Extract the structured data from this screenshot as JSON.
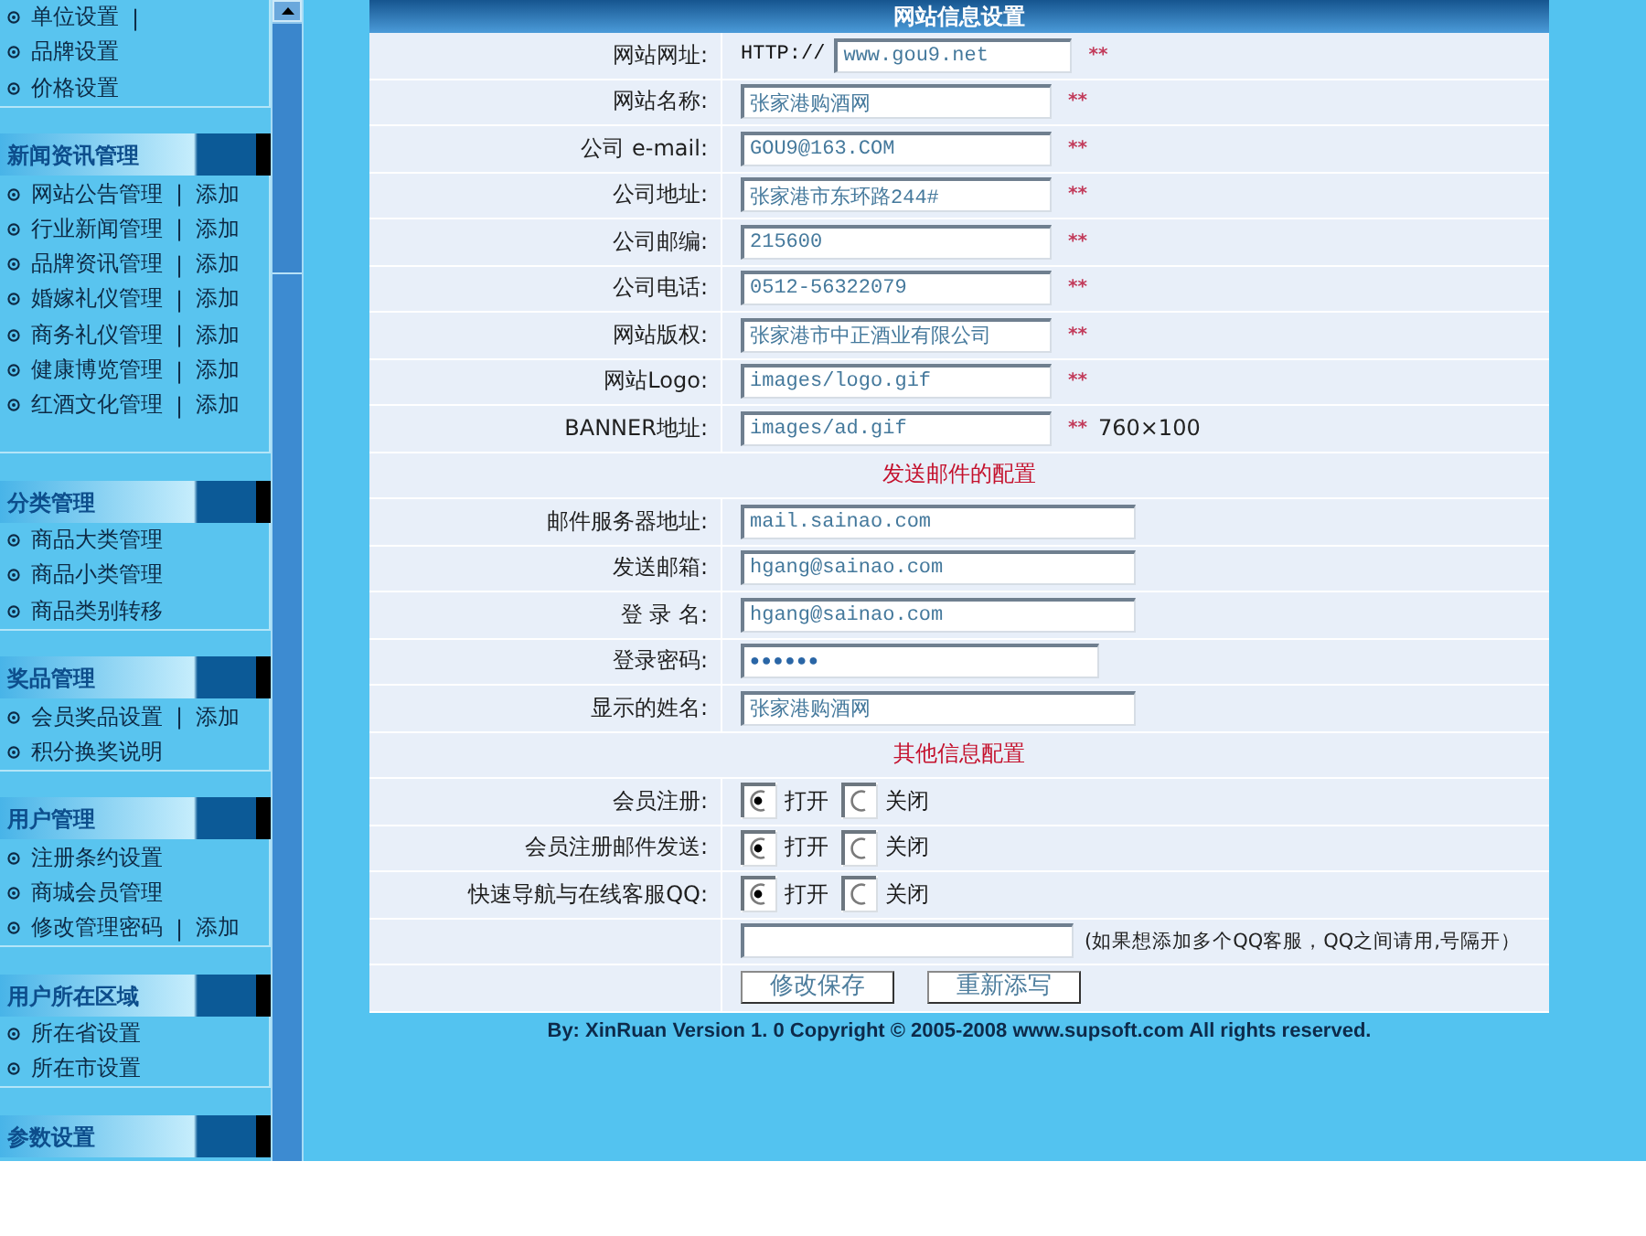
{
  "sidebar": {
    "sections": [
      {
        "items": [
          {
            "label": "单位设置",
            "separator": "|"
          },
          {
            "label": "品牌设置"
          },
          {
            "label": "价格设置"
          }
        ]
      },
      {
        "title": "新闻资讯管理",
        "items": [
          {
            "label": "网站公告管理",
            "separator": "|",
            "action": "添加"
          },
          {
            "label": "行业新闻管理",
            "separator": "|",
            "action": "添加"
          },
          {
            "label": "品牌资讯管理",
            "separator": "|",
            "action": "添加"
          },
          {
            "label": "婚嫁礼仪管理",
            "separator": "|",
            "action": "添加"
          },
          {
            "label": "商务礼仪管理",
            "separator": "|",
            "action": "添加"
          },
          {
            "label": "健康博览管理",
            "separator": "|",
            "action": "添加"
          },
          {
            "label": "红酒文化管理",
            "separator": "|",
            "action": "添加"
          }
        ]
      },
      {
        "title": "分类管理",
        "items": [
          {
            "label": "商品大类管理"
          },
          {
            "label": "商品小类管理"
          },
          {
            "label": "商品类别转移"
          }
        ]
      },
      {
        "title": "奖品管理",
        "items": [
          {
            "label": "会员奖品设置",
            "separator": "|",
            "action": "添加"
          },
          {
            "label": "积分换奖说明"
          }
        ]
      },
      {
        "title": "用户管理",
        "items": [
          {
            "label": "注册条约设置"
          },
          {
            "label": "商城会员管理"
          },
          {
            "label": "修改管理密码",
            "separator": "|",
            "action": "添加"
          }
        ]
      },
      {
        "title": "用户所在区域",
        "items": [
          {
            "label": "所在省设置"
          },
          {
            "label": "所在市设置"
          }
        ]
      },
      {
        "title": "参数设置"
      }
    ]
  },
  "form": {
    "title": "网站信息设置",
    "groups": [
      {
        "fields": [
          {
            "kind": "text",
            "label": "网站网址:",
            "prefix": "HTTP://",
            "value": "www.gou9.net",
            "required": "**"
          },
          {
            "kind": "text",
            "label": "网站名称:",
            "value": "张家港购酒网",
            "required": "**"
          },
          {
            "kind": "text",
            "label": "公司 e-mail:",
            "value": "GOU9@163.COM",
            "required": "**"
          },
          {
            "kind": "text",
            "label": "公司地址:",
            "value": "张家港市东环路244#",
            "required": "**"
          },
          {
            "kind": "text",
            "label": "公司邮编:",
            "value": "215600",
            "required": "**"
          },
          {
            "kind": "text",
            "label": "公司电话:",
            "value": "0512-56322079",
            "required": "**"
          },
          {
            "kind": "text",
            "label": "网站版权:",
            "value": "张家港市中正酒业有限公司",
            "required": "**"
          },
          {
            "kind": "text",
            "label": "网站Logo:",
            "value": "images/logo.gif",
            "required": "**"
          },
          {
            "kind": "text",
            "label": "BANNER地址:",
            "value": "images/ad.gif",
            "required": "**",
            "note": "760×100"
          }
        ]
      },
      {
        "title": "发送邮件的配置",
        "fields": [
          {
            "kind": "text",
            "label": "邮件服务器地址:",
            "value": "mail.sainao.com"
          },
          {
            "kind": "text",
            "label": "发送邮箱:",
            "value": "hgang@sainao.com"
          },
          {
            "kind": "text",
            "label": "登 录 名:",
            "value": "hgang@sainao.com"
          },
          {
            "kind": "password",
            "label": "登录密码:",
            "value": "●●●●●●"
          },
          {
            "kind": "text",
            "label": "显示的姓名:",
            "value": "张家港购酒网"
          }
        ]
      },
      {
        "title": "其他信息配置",
        "fields": [
          {
            "kind": "radio",
            "label": "会员注册:",
            "options": [
              {
                "label": "打开",
                "selected": true
              },
              {
                "label": "关闭",
                "selected": false
              }
            ]
          },
          {
            "kind": "radio",
            "label": "会员注册邮件发送:",
            "options": [
              {
                "label": "打开",
                "selected": true
              },
              {
                "label": "关闭",
                "selected": false
              }
            ]
          },
          {
            "kind": "radio",
            "label": "快速导航与在线客服QQ:",
            "options": [
              {
                "label": "打开",
                "selected": true
              },
              {
                "label": "关闭",
                "selected": false
              }
            ]
          },
          {
            "kind": "text",
            "note": "(如果想添加多个QQ客服，QQ之间请用,号隔开）"
          },
          {
            "kind": "buttons",
            "buttons": [
              "修改保存",
              "重新添写"
            ]
          }
        ]
      }
    ]
  },
  "footer": "By: XinRuan Version 1. 0 Copyright © 2005-2008 www.supsoft.com All rights reserved."
}
